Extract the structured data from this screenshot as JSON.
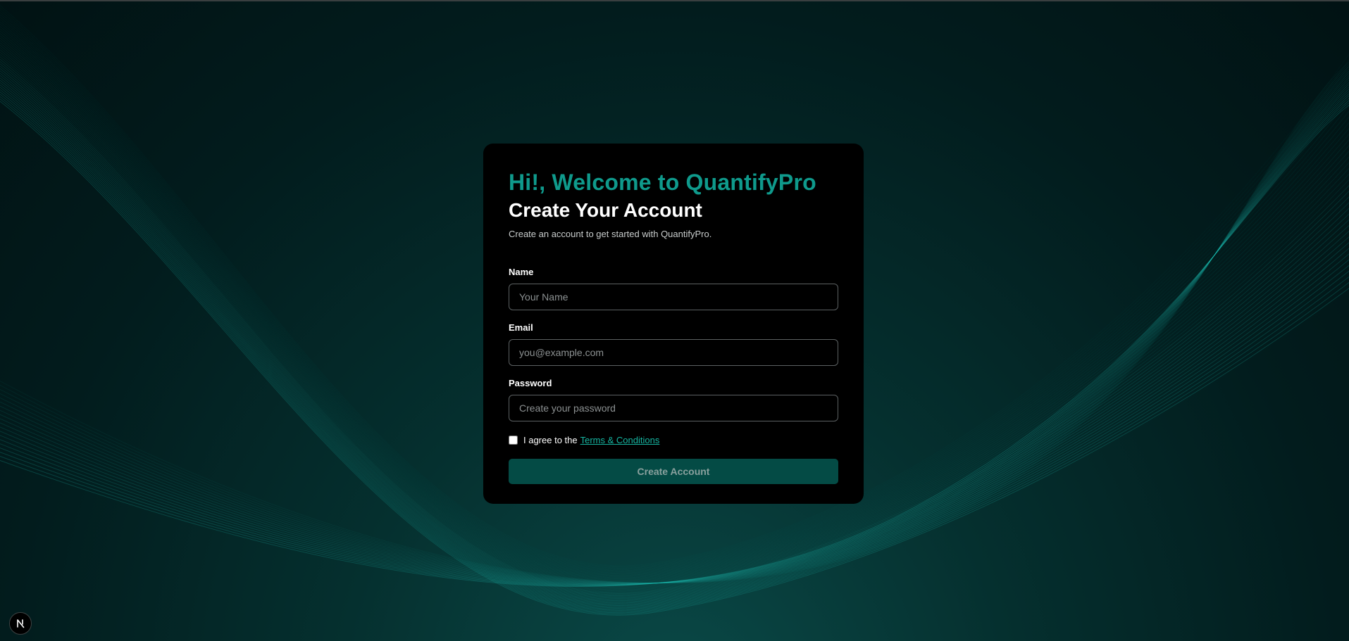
{
  "app": {
    "brand_color": "#0f9a8c",
    "link_color": "#16b6a2",
    "button_color": "#044b45"
  },
  "card": {
    "welcome": "Hi!, Welcome to QuantifyPro",
    "heading": "Create Your Account",
    "subtitle": "Create an account to get started with QuantifyPro."
  },
  "form": {
    "name": {
      "label": "Name",
      "placeholder": "Your Name",
      "value": ""
    },
    "email": {
      "label": "Email",
      "placeholder": "you@example.com",
      "value": ""
    },
    "password": {
      "label": "Password",
      "placeholder": "Create your password",
      "value": ""
    },
    "terms": {
      "text": "I agree to the",
      "link": "Terms & Conditions",
      "checked": false
    },
    "submit_label": "Create Account"
  },
  "dev_indicator": {
    "icon": "nextjs-logo-icon",
    "letter": "N"
  }
}
